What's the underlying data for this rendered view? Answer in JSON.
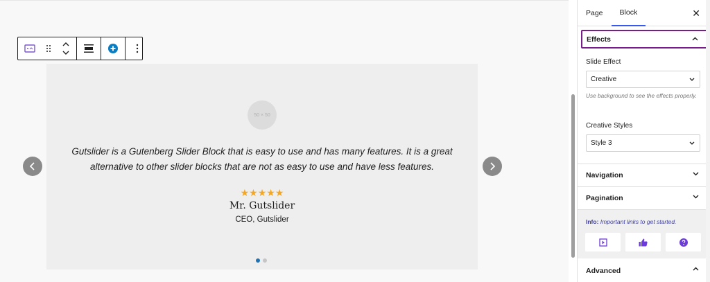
{
  "slider": {
    "avatar_text": "50 × 50",
    "quote": "Gutslider is a Gutenberg Slider Block that is easy to use and has many features. It is a great alternative to other slider blocks that are not as easy to use and have less features.",
    "stars": "★★★★★",
    "rating": 5,
    "name": "Mr. Gutslider",
    "role": "CEO, Gutslider",
    "slide_count": 2,
    "active_slide": 1
  },
  "sidebar": {
    "tabs": [
      {
        "label": "Page"
      },
      {
        "label": "Block"
      }
    ],
    "close_symbol": "✕",
    "effects": {
      "title": "Effects",
      "slide_effect_label": "Slide Effect",
      "slide_effect_value": "Creative",
      "help_text": "Use background to see the effects properly.",
      "creative_styles_label": "Creative Styles",
      "creative_styles_value": "Style 3"
    },
    "navigation_title": "Navigation",
    "pagination_title": "Pagination",
    "info": {
      "label": "Info:",
      "text": "Important links to get started."
    },
    "advanced_title": "Advanced"
  },
  "colors": {
    "accent_purple": "#7a1b8c",
    "tab_underline": "#3858e9",
    "star": "#f5a623",
    "info_icon": "#6c3bd9",
    "add_button": "#0a7cc2"
  }
}
